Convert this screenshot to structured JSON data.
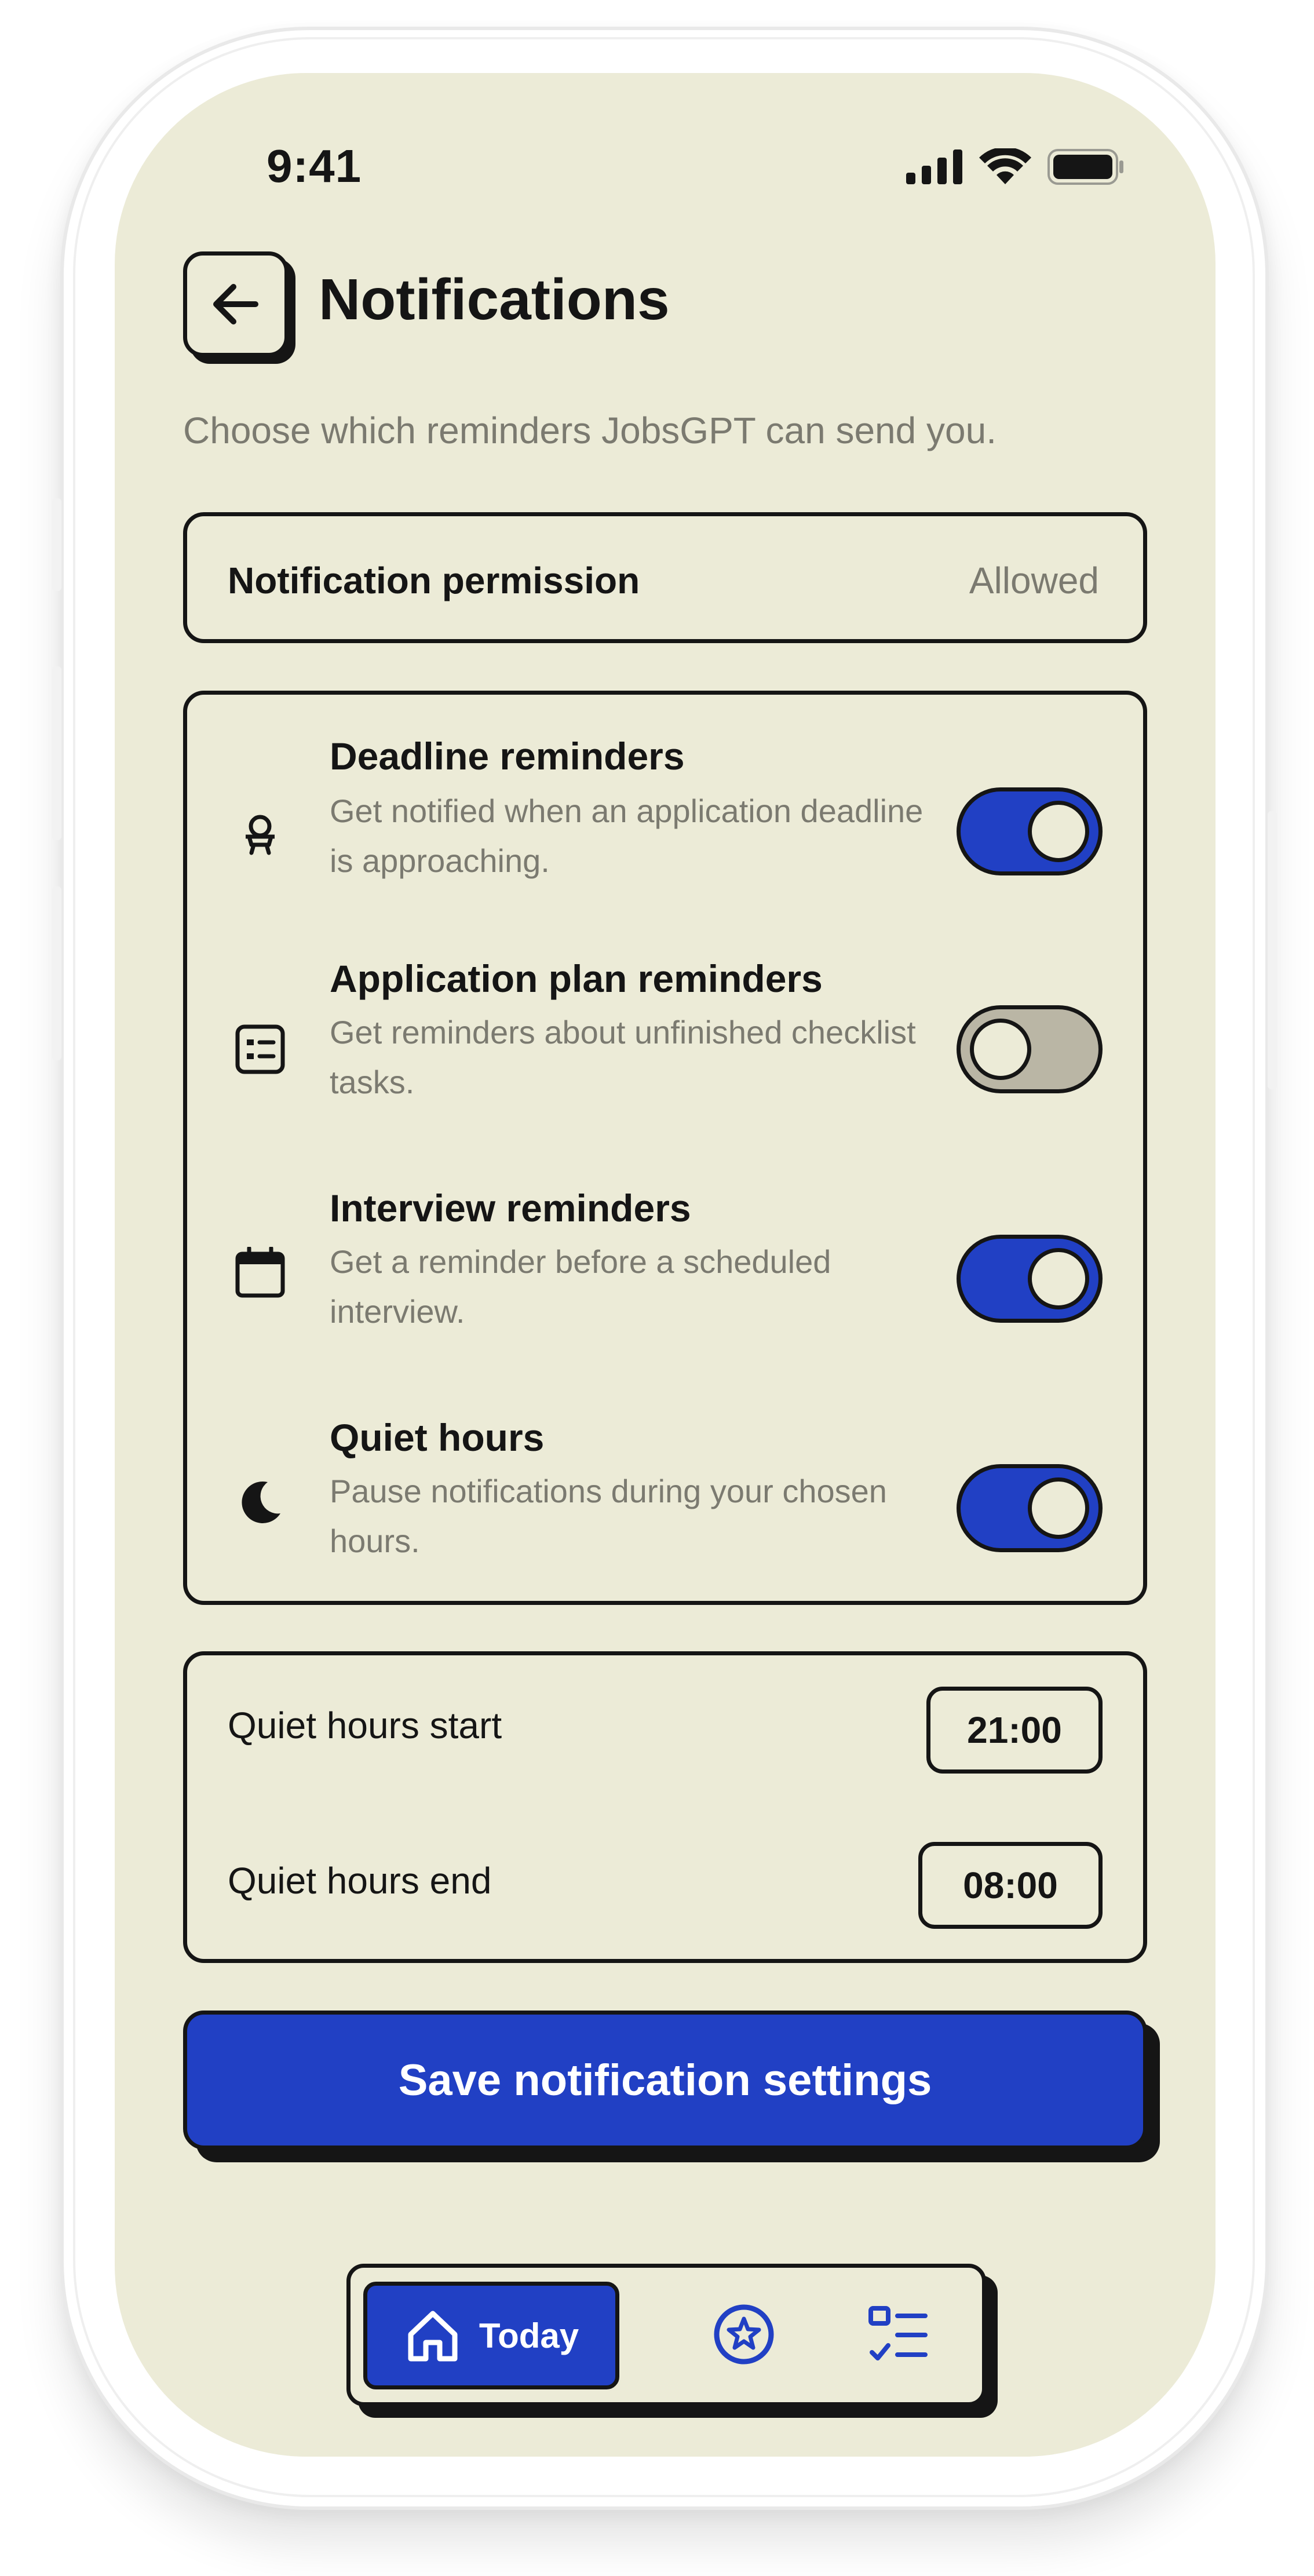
{
  "status_bar": {
    "time": "9:41",
    "icons": [
      "cellular-signal-icon",
      "wifi-icon",
      "battery-icon"
    ]
  },
  "header": {
    "back_icon": "arrow-left-icon",
    "title": "Notifications",
    "subtitle": "Choose which reminders JobsGPT can send you."
  },
  "permission": {
    "label": "Notification permission",
    "value": "Allowed"
  },
  "toggles": [
    {
      "icon": "alarm-bell-icon",
      "title": "Deadline reminders",
      "description": "Get notified when an application deadline is approaching.",
      "enabled": true
    },
    {
      "icon": "checklist-icon",
      "title": "Application plan reminders",
      "description": "Get reminders about unfinished checklist tasks.",
      "enabled": false
    },
    {
      "icon": "calendar-icon",
      "title": "Interview reminders",
      "description": "Get a reminder before a scheduled interview.",
      "enabled": true
    },
    {
      "icon": "moon-icon",
      "title": "Quiet hours",
      "description": "Pause notifications during your chosen hours.",
      "enabled": true
    }
  ],
  "quiet_hours": {
    "start_label": "Quiet hours start",
    "start_value": "21:00",
    "end_label": "Quiet hours end",
    "end_value": "08:00"
  },
  "save_button": {
    "label": "Save notification settings"
  },
  "bottom_nav": {
    "today_label": "Today",
    "today_icon": "home-icon",
    "items": [
      "star-badge-icon",
      "tasks-list-icon"
    ]
  },
  "colors": {
    "background": "#ecebd7",
    "accent": "#2140c4",
    "ink": "#151515",
    "muted_text": "#7b7a70",
    "toggle_off": "#bab6a5"
  }
}
